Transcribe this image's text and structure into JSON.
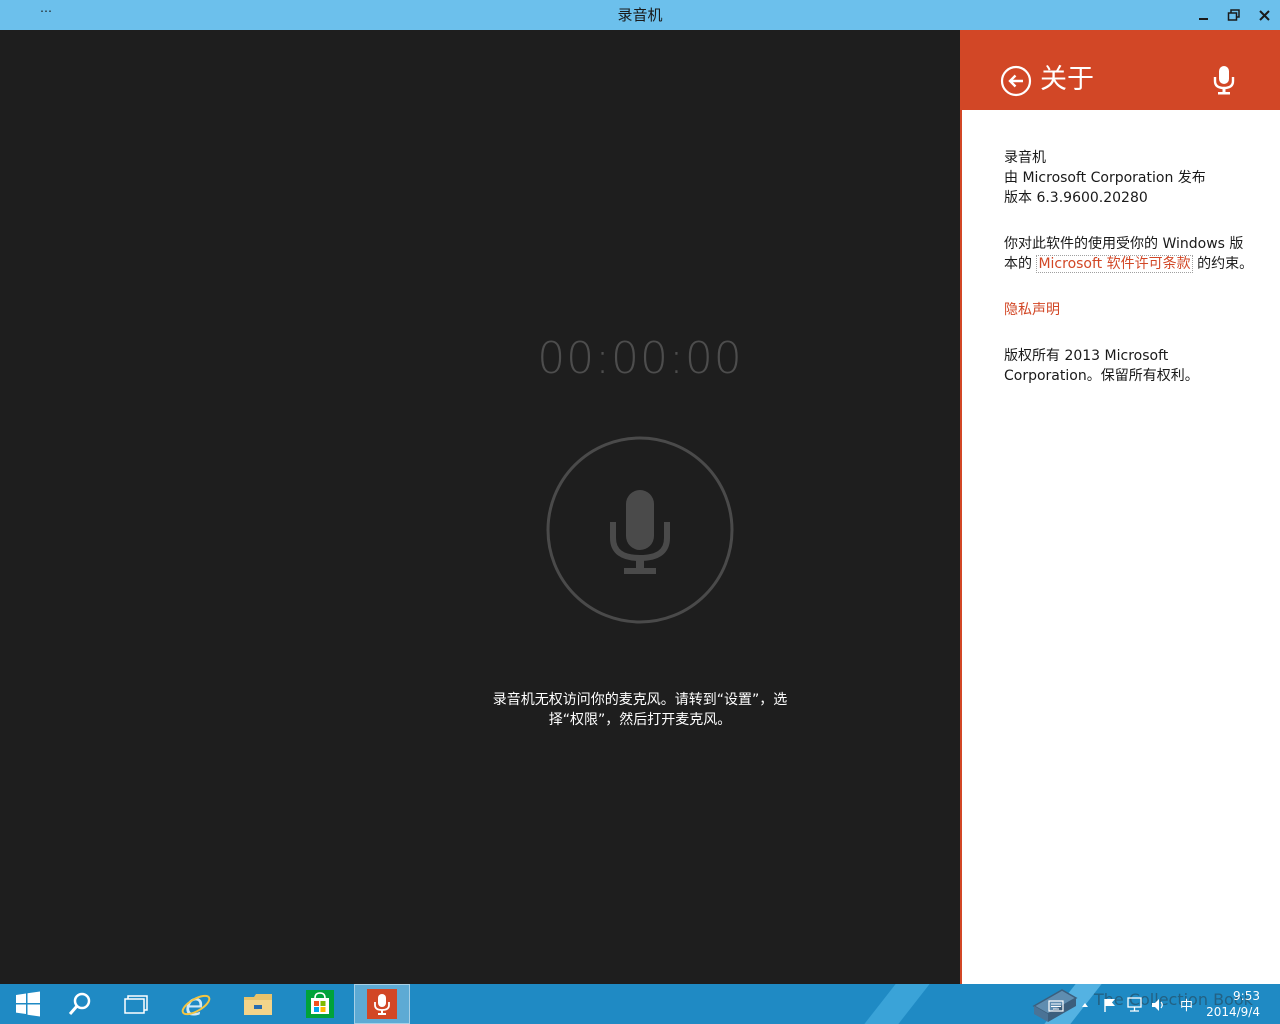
{
  "window": {
    "title": "录音机",
    "menu_glyph": "⋯",
    "buttons": [
      "minimize-icon",
      "restore-icon",
      "close-icon"
    ]
  },
  "recorder": {
    "timer": "00:00:00",
    "record_icon": "microphone-icon",
    "message": "录音机无权访问你的麦克风。请转到“设置”，选择“权限”，然后打开麦克风。"
  },
  "about_pane": {
    "title": "关于",
    "accent": "#d24726",
    "app_name": "录音机",
    "publisher": "由 Microsoft Corporation 发布",
    "version": "版本 6.3.9600.20280",
    "license_before": "你对此软件的使用受你的 Windows 版本的 ",
    "license_link": "Microsoft 软件许可条款",
    "license_after": " 的约束。",
    "privacy_link": "隐私声明",
    "copyright": "版权所有 2013 Microsoft Corporation。保留所有权利。"
  },
  "taskbar": {
    "color": "#1f8ac4",
    "items": [
      "start-icon",
      "search-icon",
      "task-view-icon",
      "internet-explorer-icon",
      "file-explorer-icon",
      "store-icon",
      "sound-recorder-icon"
    ],
    "tray": [
      "keyboard-icon",
      "show-hidden-icons-chevron",
      "action-center-flag-icon",
      "network-icon",
      "volume-icon"
    ],
    "ime": "中",
    "time": "9:53",
    "date": "2014/9/4",
    "watermark": "The Collection Book"
  }
}
